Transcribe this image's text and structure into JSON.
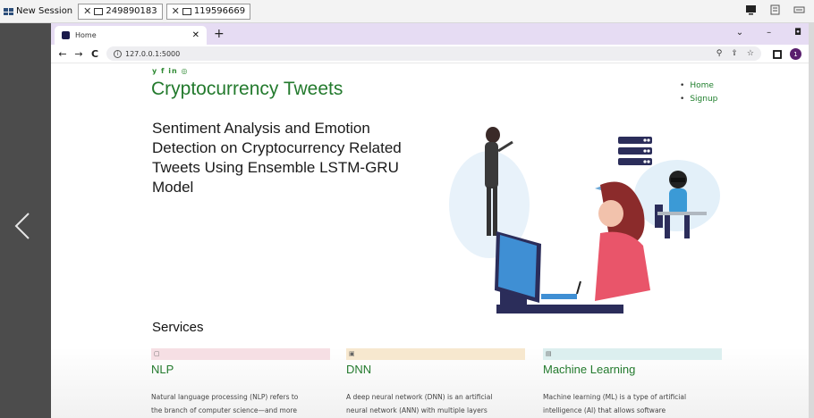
{
  "session": {
    "title": "New Session",
    "tabs": [
      {
        "id": "249890183"
      },
      {
        "id": "119596669"
      }
    ]
  },
  "browser": {
    "tab_title": "Home",
    "new_tab": "+",
    "url": "127.0.0.1:5000"
  },
  "page": {
    "social": "y f in ◎",
    "title": "Cryptocurrency Tweets",
    "nav": [
      "Home",
      "Signup"
    ],
    "headline": "Sentiment Analysis and Emotion Detection on Cryptocurrency Related Tweets Using Ensemble LSTM-GRU Model",
    "services_title": "Services",
    "services": [
      {
        "name": "NLP",
        "icon": "▢",
        "color": "#f6dfe4",
        "desc_line1": "Natural language processing (NLP) refers to",
        "desc_line2": "the branch of computer science—and more"
      },
      {
        "name": "DNN",
        "icon": "▣",
        "color": "#f7e8cf",
        "desc_line1": "A deep neural network (DNN) is an artificial",
        "desc_line2": "neural network (ANN) with multiple layers"
      },
      {
        "name": "Machine Learning",
        "icon": "▤",
        "color": "#dcefef",
        "desc_line1": "Machine learning (ML) is a type of artificial",
        "desc_line2": "intelligence (AI) that allows software"
      }
    ]
  },
  "colors": {
    "brand_green": "#237a2d",
    "tabstrip": "#e6dcf3",
    "illustration_pink": "#e9556a",
    "illustration_navy": "#2b2d5a"
  }
}
